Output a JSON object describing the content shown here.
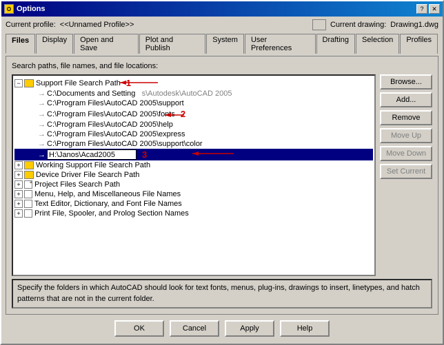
{
  "window": {
    "title": "Options",
    "title_icon": "O",
    "current_profile_label": "Current profile:",
    "current_profile_value": "<<Unnamed Profile>>",
    "current_drawing_label": "Current drawing:",
    "current_drawing_value": "Drawing1.dwg"
  },
  "title_buttons": {
    "help": "?",
    "close": "✕"
  },
  "tabs": [
    {
      "label": "Files",
      "active": true
    },
    {
      "label": "Display",
      "active": false
    },
    {
      "label": "Open and Save",
      "active": false
    },
    {
      "label": "Plot and Publish",
      "active": false
    },
    {
      "label": "System",
      "active": false
    },
    {
      "label": "User Preferences",
      "active": false
    },
    {
      "label": "Drafting",
      "active": false
    },
    {
      "label": "Selection",
      "active": false
    },
    {
      "label": "Profiles",
      "active": false
    }
  ],
  "content": {
    "search_paths_label": "Search paths, file names, and file locations:",
    "tree": [
      {
        "id": "support-path",
        "level": 0,
        "expanded": true,
        "icon": "folder",
        "label": "Support File Search Path",
        "annotation": "1"
      },
      {
        "id": "docs-setting",
        "level": 1,
        "expanded": false,
        "icon": "arrow",
        "label": "C:\\Documents and Setting     s\\Autodesk\\AutoCAD 2005"
      },
      {
        "id": "program-support",
        "level": 1,
        "expanded": false,
        "icon": "arrow",
        "label": "C:\\Program Files\\AutoCAD 2005\\support"
      },
      {
        "id": "program-fonts",
        "level": 1,
        "expanded": false,
        "icon": "arrow",
        "label": "C:\\Program Files\\AutoCAD 2005\\fonts",
        "annotation": "2"
      },
      {
        "id": "program-help",
        "level": 1,
        "expanded": false,
        "icon": "arrow",
        "label": "C:\\Program Files\\AutoCAD 2005\\help"
      },
      {
        "id": "program-express",
        "level": 1,
        "expanded": false,
        "icon": "arrow",
        "label": "C:\\Program Files\\AutoCAD 2005\\express"
      },
      {
        "id": "program-color",
        "level": 1,
        "expanded": false,
        "icon": "arrow",
        "label": "C:\\Program Files\\AutoCAD 2005\\support\\color"
      },
      {
        "id": "janos",
        "level": 1,
        "expanded": false,
        "icon": "arrow-edit",
        "label": "H:\\Janos\\Acad2005",
        "annotation": "3",
        "selected": true
      },
      {
        "id": "working-path",
        "level": 0,
        "expanded": false,
        "icon": "folder",
        "label": "Working Support File Search Path"
      },
      {
        "id": "device-path",
        "level": 0,
        "expanded": false,
        "icon": "folder",
        "label": "Device Driver File Search Path"
      },
      {
        "id": "project-path",
        "level": 0,
        "expanded": false,
        "icon": "file",
        "label": "Project Files Search Path"
      },
      {
        "id": "menu-names",
        "level": 0,
        "expanded": false,
        "icon": "file2",
        "label": "Menu, Help, and Miscellaneous File Names"
      },
      {
        "id": "text-editor",
        "level": 0,
        "expanded": false,
        "icon": "file2",
        "label": "Text Editor, Dictionary, and Font File Names"
      },
      {
        "id": "print-file",
        "level": 0,
        "expanded": false,
        "icon": "file3",
        "label": "Print File, Spooler, and Prolog Section Names"
      }
    ],
    "buttons": [
      {
        "label": "Browse...",
        "disabled": false
      },
      {
        "label": "Add...",
        "disabled": false
      },
      {
        "label": "Remove",
        "disabled": false
      },
      {
        "label": "Move Up",
        "disabled": true
      },
      {
        "label": "Move Down",
        "disabled": true
      },
      {
        "label": "Set Current",
        "disabled": true
      }
    ],
    "description": "Specify the folders in which AutoCAD should look for text fonts, menus, plug-ins, drawings to insert, linetypes, and hatch patterns that are not in the current folder."
  },
  "bottom_buttons": [
    {
      "label": "OK"
    },
    {
      "label": "Cancel"
    },
    {
      "label": "Apply"
    },
    {
      "label": "Help"
    }
  ]
}
